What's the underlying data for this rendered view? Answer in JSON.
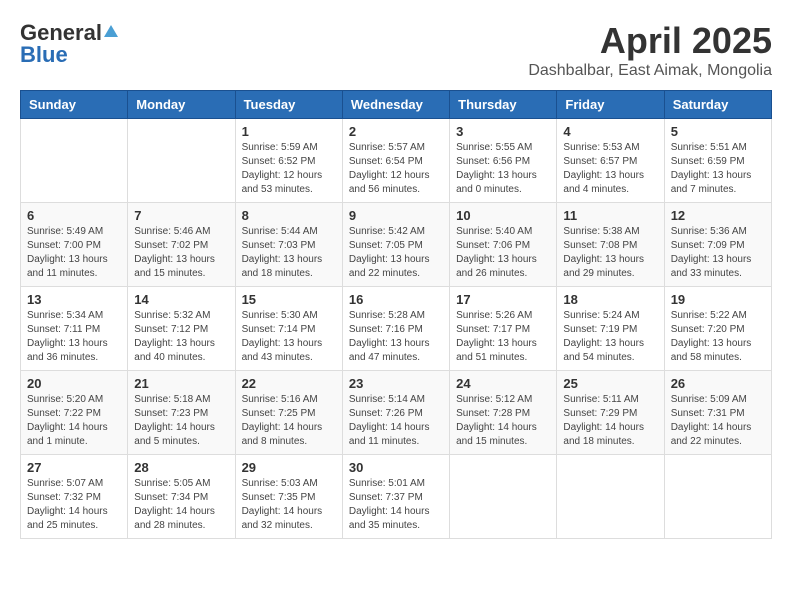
{
  "logo": {
    "general": "General",
    "blue": "Blue"
  },
  "title": {
    "month": "April 2025",
    "location": "Dashbalbar, East Aimak, Mongolia"
  },
  "headers": [
    "Sunday",
    "Monday",
    "Tuesday",
    "Wednesday",
    "Thursday",
    "Friday",
    "Saturday"
  ],
  "weeks": [
    [
      {
        "day": "",
        "info": ""
      },
      {
        "day": "",
        "info": ""
      },
      {
        "day": "1",
        "info": "Sunrise: 5:59 AM\nSunset: 6:52 PM\nDaylight: 12 hours\nand 53 minutes."
      },
      {
        "day": "2",
        "info": "Sunrise: 5:57 AM\nSunset: 6:54 PM\nDaylight: 12 hours\nand 56 minutes."
      },
      {
        "day": "3",
        "info": "Sunrise: 5:55 AM\nSunset: 6:56 PM\nDaylight: 13 hours\nand 0 minutes."
      },
      {
        "day": "4",
        "info": "Sunrise: 5:53 AM\nSunset: 6:57 PM\nDaylight: 13 hours\nand 4 minutes."
      },
      {
        "day": "5",
        "info": "Sunrise: 5:51 AM\nSunset: 6:59 PM\nDaylight: 13 hours\nand 7 minutes."
      }
    ],
    [
      {
        "day": "6",
        "info": "Sunrise: 5:49 AM\nSunset: 7:00 PM\nDaylight: 13 hours\nand 11 minutes."
      },
      {
        "day": "7",
        "info": "Sunrise: 5:46 AM\nSunset: 7:02 PM\nDaylight: 13 hours\nand 15 minutes."
      },
      {
        "day": "8",
        "info": "Sunrise: 5:44 AM\nSunset: 7:03 PM\nDaylight: 13 hours\nand 18 minutes."
      },
      {
        "day": "9",
        "info": "Sunrise: 5:42 AM\nSunset: 7:05 PM\nDaylight: 13 hours\nand 22 minutes."
      },
      {
        "day": "10",
        "info": "Sunrise: 5:40 AM\nSunset: 7:06 PM\nDaylight: 13 hours\nand 26 minutes."
      },
      {
        "day": "11",
        "info": "Sunrise: 5:38 AM\nSunset: 7:08 PM\nDaylight: 13 hours\nand 29 minutes."
      },
      {
        "day": "12",
        "info": "Sunrise: 5:36 AM\nSunset: 7:09 PM\nDaylight: 13 hours\nand 33 minutes."
      }
    ],
    [
      {
        "day": "13",
        "info": "Sunrise: 5:34 AM\nSunset: 7:11 PM\nDaylight: 13 hours\nand 36 minutes."
      },
      {
        "day": "14",
        "info": "Sunrise: 5:32 AM\nSunset: 7:12 PM\nDaylight: 13 hours\nand 40 minutes."
      },
      {
        "day": "15",
        "info": "Sunrise: 5:30 AM\nSunset: 7:14 PM\nDaylight: 13 hours\nand 43 minutes."
      },
      {
        "day": "16",
        "info": "Sunrise: 5:28 AM\nSunset: 7:16 PM\nDaylight: 13 hours\nand 47 minutes."
      },
      {
        "day": "17",
        "info": "Sunrise: 5:26 AM\nSunset: 7:17 PM\nDaylight: 13 hours\nand 51 minutes."
      },
      {
        "day": "18",
        "info": "Sunrise: 5:24 AM\nSunset: 7:19 PM\nDaylight: 13 hours\nand 54 minutes."
      },
      {
        "day": "19",
        "info": "Sunrise: 5:22 AM\nSunset: 7:20 PM\nDaylight: 13 hours\nand 58 minutes."
      }
    ],
    [
      {
        "day": "20",
        "info": "Sunrise: 5:20 AM\nSunset: 7:22 PM\nDaylight: 14 hours\nand 1 minute."
      },
      {
        "day": "21",
        "info": "Sunrise: 5:18 AM\nSunset: 7:23 PM\nDaylight: 14 hours\nand 5 minutes."
      },
      {
        "day": "22",
        "info": "Sunrise: 5:16 AM\nSunset: 7:25 PM\nDaylight: 14 hours\nand 8 minutes."
      },
      {
        "day": "23",
        "info": "Sunrise: 5:14 AM\nSunset: 7:26 PM\nDaylight: 14 hours\nand 11 minutes."
      },
      {
        "day": "24",
        "info": "Sunrise: 5:12 AM\nSunset: 7:28 PM\nDaylight: 14 hours\nand 15 minutes."
      },
      {
        "day": "25",
        "info": "Sunrise: 5:11 AM\nSunset: 7:29 PM\nDaylight: 14 hours\nand 18 minutes."
      },
      {
        "day": "26",
        "info": "Sunrise: 5:09 AM\nSunset: 7:31 PM\nDaylight: 14 hours\nand 22 minutes."
      }
    ],
    [
      {
        "day": "27",
        "info": "Sunrise: 5:07 AM\nSunset: 7:32 PM\nDaylight: 14 hours\nand 25 minutes."
      },
      {
        "day": "28",
        "info": "Sunrise: 5:05 AM\nSunset: 7:34 PM\nDaylight: 14 hours\nand 28 minutes."
      },
      {
        "day": "29",
        "info": "Sunrise: 5:03 AM\nSunset: 7:35 PM\nDaylight: 14 hours\nand 32 minutes."
      },
      {
        "day": "30",
        "info": "Sunrise: 5:01 AM\nSunset: 7:37 PM\nDaylight: 14 hours\nand 35 minutes."
      },
      {
        "day": "",
        "info": ""
      },
      {
        "day": "",
        "info": ""
      },
      {
        "day": "",
        "info": ""
      }
    ]
  ]
}
